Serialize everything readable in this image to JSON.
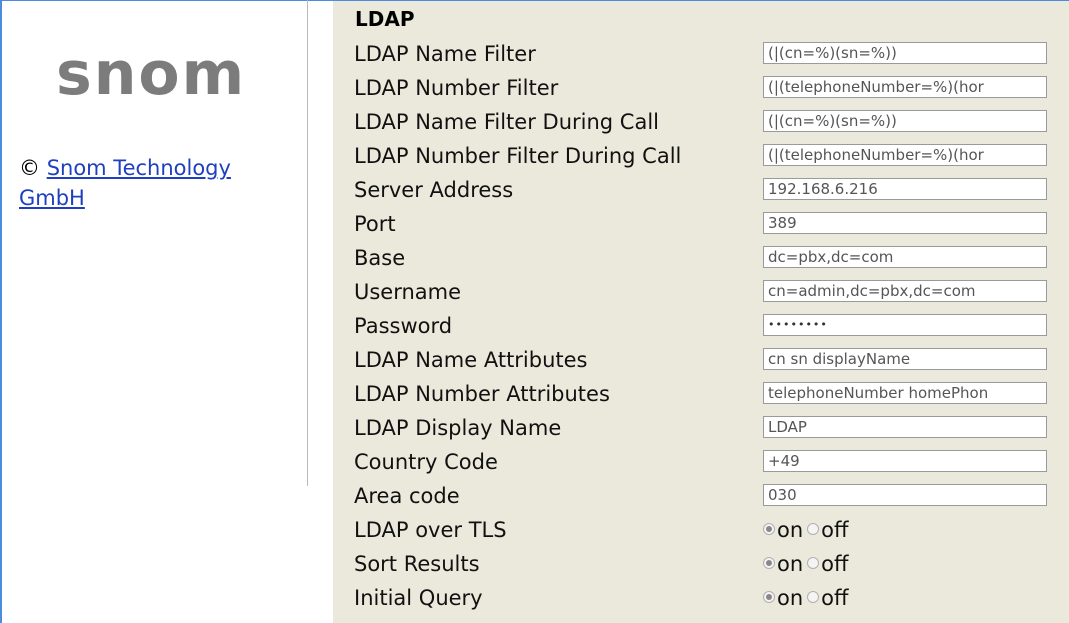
{
  "sidebar": {
    "logo": "snom",
    "copyright_symbol": "©",
    "company_link": "Snom Technology GmbH"
  },
  "main": {
    "section_title": "LDAP",
    "fields": [
      {
        "label": "LDAP Name Filter",
        "value": "(|(cn=%)(sn=%))"
      },
      {
        "label": "LDAP Number Filter",
        "value": "(|(telephoneNumber=%)(hor"
      },
      {
        "label": "LDAP Name Filter During Call",
        "value": "(|(cn=%)(sn=%))"
      },
      {
        "label": "LDAP Number Filter During Call",
        "value": "(|(telephoneNumber=%)(hor"
      },
      {
        "label": "Server Address",
        "value": "192.168.6.216"
      },
      {
        "label": "Port",
        "value": "389"
      },
      {
        "label": "Base",
        "value": "dc=pbx,dc=com"
      },
      {
        "label": "Username",
        "value": "cn=admin,dc=pbx,dc=com"
      },
      {
        "label": "Password",
        "value": "••••••••"
      },
      {
        "label": "LDAP Name Attributes",
        "value": "cn sn displayName"
      },
      {
        "label": "LDAP Number Attributes",
        "value": "telephoneNumber homePhon"
      },
      {
        "label": "LDAP Display Name",
        "value": "LDAP"
      },
      {
        "label": "Country Code",
        "value": "+49"
      },
      {
        "label": "Area code",
        "value": "030"
      }
    ],
    "toggles": [
      {
        "label": "LDAP over TLS",
        "on_label": "on",
        "off_label": "off",
        "selected": "on"
      },
      {
        "label": "Sort Results",
        "on_label": "on",
        "off_label": "off",
        "selected": "on"
      },
      {
        "label": "Initial Query",
        "on_label": "on",
        "off_label": "off",
        "selected": "on"
      }
    ]
  },
  "colors": {
    "panel_bg": "#ebe9dc",
    "link": "#1f3fbf",
    "logo": "#7c7c7c",
    "frame": "#4b8be0"
  }
}
